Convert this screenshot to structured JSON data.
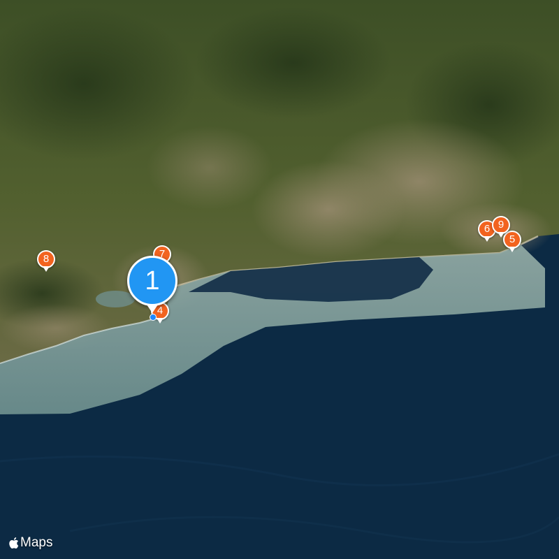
{
  "map": {
    "attribution": {
      "logo_icon": "apple-logo-icon",
      "label": "Maps"
    },
    "colors": {
      "pin": "#f2631f",
      "selected_pin": "#2196f3",
      "ocean": "#0c2a44",
      "shallows": "#7f9f9c",
      "land": "#4b5d2e"
    },
    "markers": [
      {
        "id": "marker-1",
        "label": "1",
        "selected": true
      },
      {
        "id": "marker-4",
        "label": "4",
        "selected": false
      },
      {
        "id": "marker-5",
        "label": "5",
        "selected": false
      },
      {
        "id": "marker-6",
        "label": "6",
        "selected": false
      },
      {
        "id": "marker-7",
        "label": "7",
        "selected": false
      },
      {
        "id": "marker-8",
        "label": "8",
        "selected": false
      },
      {
        "id": "marker-9",
        "label": "9",
        "selected": false
      }
    ]
  }
}
